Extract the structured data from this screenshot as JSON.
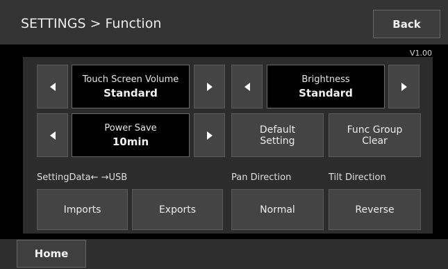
{
  "header": {
    "title": "SETTINGS > Function",
    "back_label": "Back"
  },
  "version": "V1.00",
  "touch_screen_volume": {
    "label": "Touch Screen Volume",
    "value": "Standard"
  },
  "brightness": {
    "label": "Brightness",
    "value": "Standard"
  },
  "power_save": {
    "label": "Power Save",
    "value": "10min"
  },
  "default_setting": {
    "line1": "Default",
    "line2": "Setting"
  },
  "func_group_clear": {
    "line1": "Func Group",
    "line2": "Clear"
  },
  "setting_data": {
    "label": "SettingData← →USB",
    "imports": "Imports",
    "exports": "Exports"
  },
  "pan_direction": {
    "label": "Pan Direction",
    "value": "Normal"
  },
  "tilt_direction": {
    "label": "Tilt Direction",
    "value": "Reverse"
  },
  "footer": {
    "home_label": "Home"
  },
  "icons": {
    "left": "triangle-left-icon",
    "right": "triangle-right-icon"
  },
  "colors": {
    "background": "#000000",
    "header": "#333333",
    "panel": "#2c2c2c",
    "button": "#444444"
  }
}
